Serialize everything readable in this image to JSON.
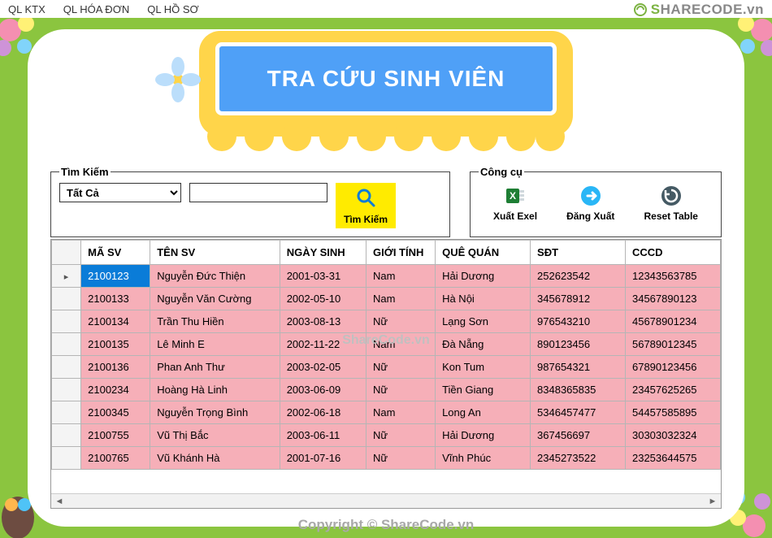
{
  "menu": {
    "items": [
      "QL KTX",
      "QL HÓA ĐƠN",
      "QL HỒ SƠ"
    ]
  },
  "banner": {
    "title": "TRA CỨU SINH VIÊN"
  },
  "search": {
    "legend": "Tìm Kiếm",
    "combo_value": "Tất Cả",
    "text_value": "",
    "button_label": "Tìm Kiếm"
  },
  "tools": {
    "legend": "Công cụ",
    "export_label": "Xuất Exel",
    "logout_label": "Đăng Xuất",
    "reset_label": "Reset Table"
  },
  "grid": {
    "columns": [
      "MÃ SV",
      "TÊN SV",
      "NGÀY SINH",
      "GIỚI TÍNH",
      "QUÊ QUÁN",
      "SĐT",
      "CCCD"
    ],
    "rows": [
      {
        "masv": "2100123",
        "ten": "Nguyễn Đức Thiện",
        "ns": "2001-03-31",
        "gt": "Nam",
        "qq": "Hải Dương",
        "sdt": "252623542",
        "cccd": "12343563785"
      },
      {
        "masv": "2100133",
        "ten": "Nguyễn Văn Cường",
        "ns": "2002-05-10",
        "gt": "Nam",
        "qq": "Hà Nội",
        "sdt": "345678912",
        "cccd": "34567890123"
      },
      {
        "masv": "2100134",
        "ten": "Trần Thu Hiền",
        "ns": "2003-08-13",
        "gt": "Nữ",
        "qq": "Lạng Sơn",
        "sdt": "976543210",
        "cccd": "45678901234"
      },
      {
        "masv": "2100135",
        "ten": "Lê Minh E",
        "ns": "2002-11-22",
        "gt": "Nam",
        "qq": "Đà Nẵng",
        "sdt": "890123456",
        "cccd": "56789012345"
      },
      {
        "masv": "2100136",
        "ten": "Phan Anh Thư",
        "ns": "2003-02-05",
        "gt": "Nữ",
        "qq": "Kon Tum",
        "sdt": "987654321",
        "cccd": "67890123456"
      },
      {
        "masv": "2100234",
        "ten": "Hoàng Hà Linh",
        "ns": "2003-06-09",
        "gt": "Nữ",
        "qq": "Tiền Giang",
        "sdt": "8348365835",
        "cccd": "23457625265"
      },
      {
        "masv": "2100345",
        "ten": "Nguyễn Trọng Bình",
        "ns": "2002-06-18",
        "gt": "Nam",
        "qq": "Long An",
        "sdt": "5346457477",
        "cccd": "54457585895"
      },
      {
        "masv": "2100755",
        "ten": "Vũ Thị Bắc",
        "ns": "2003-06-11",
        "gt": "Nữ",
        "qq": "Hải Dương",
        "sdt": "367456697",
        "cccd": "30303032324"
      },
      {
        "masv": "2100765",
        "ten": "Vũ Khánh Hà",
        "ns": "2001-07-16",
        "gt": "Nữ",
        "qq": "Vĩnh Phúc",
        "sdt": "2345273522",
        "cccd": "23253644575"
      }
    ]
  },
  "watermark": {
    "logo_text": "HARECODE.vn",
    "center_text": "ShareCode.vn",
    "footer_text": "Copyright © ShareCode.vn"
  }
}
